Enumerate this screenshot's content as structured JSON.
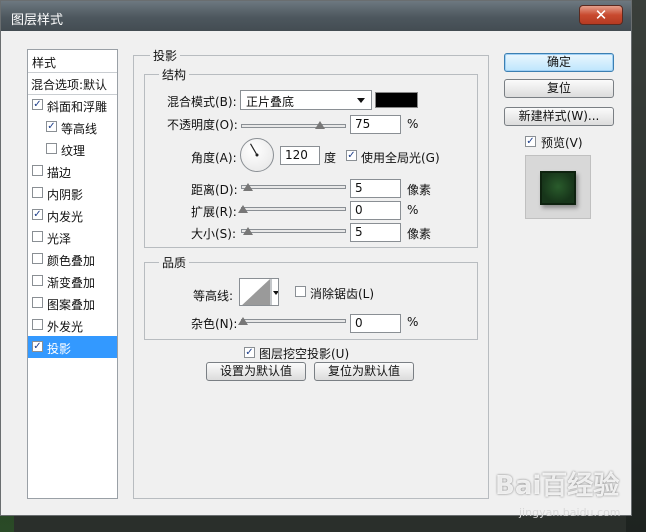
{
  "window": {
    "title": "图层样式",
    "close_glyph": "✕"
  },
  "style_list": {
    "header": "样式",
    "blend_default": "混合选项:默认",
    "items": [
      {
        "label": "斜面和浮雕",
        "checked": true,
        "indent": false
      },
      {
        "label": "等高线",
        "checked": true,
        "indent": true
      },
      {
        "label": "纹理",
        "checked": false,
        "indent": true
      },
      {
        "label": "描边",
        "checked": false,
        "indent": false
      },
      {
        "label": "内阴影",
        "checked": false,
        "indent": false
      },
      {
        "label": "内发光",
        "checked": true,
        "indent": false
      },
      {
        "label": "光泽",
        "checked": false,
        "indent": false
      },
      {
        "label": "颜色叠加",
        "checked": false,
        "indent": false
      },
      {
        "label": "渐变叠加",
        "checked": false,
        "indent": false
      },
      {
        "label": "图案叠加",
        "checked": false,
        "indent": false
      },
      {
        "label": "外发光",
        "checked": false,
        "indent": false
      },
      {
        "label": "投影",
        "checked": true,
        "indent": false,
        "selected": true
      }
    ]
  },
  "drop_shadow": {
    "section_title": "投影",
    "structure": {
      "title": "结构",
      "blend_mode_label": "混合模式(B):",
      "blend_mode_value": "正片叠底",
      "shadow_color": "#000000",
      "opacity_label": "不透明度(O):",
      "opacity_value": "75",
      "opacity_unit": "%",
      "opacity_fraction": 0.75,
      "angle_label": "角度(A):",
      "angle_value": "120",
      "angle_unit": "度",
      "angle_degrees": 120,
      "global_light_label": "使用全局光(G)",
      "global_light_checked": true,
      "distance_label": "距离(D):",
      "distance_value": "5",
      "distance_unit": "像素",
      "spread_label": "扩展(R):",
      "spread_value": "0",
      "spread_unit": "%",
      "size_label": "大小(S):",
      "size_value": "5",
      "size_unit": "像素"
    },
    "quality": {
      "title": "品质",
      "contour_label": "等高线:",
      "anti_alias_label": "消除锯齿(L)",
      "anti_alias_checked": false,
      "noise_label": "杂色(N):",
      "noise_value": "0",
      "noise_unit": "%"
    },
    "knockout_label": "图层挖空投影(U)",
    "knockout_checked": true,
    "make_default_label": "设置为默认值",
    "reset_default_label": "复位为默认值"
  },
  "buttons": {
    "ok": "确定",
    "reset": "复位",
    "new_style": "新建样式(W)...",
    "preview_label": "预览(V)",
    "preview_checked": true
  },
  "watermark": {
    "logo": "Bai百经验",
    "url": "jingyan.baidu.com"
  }
}
